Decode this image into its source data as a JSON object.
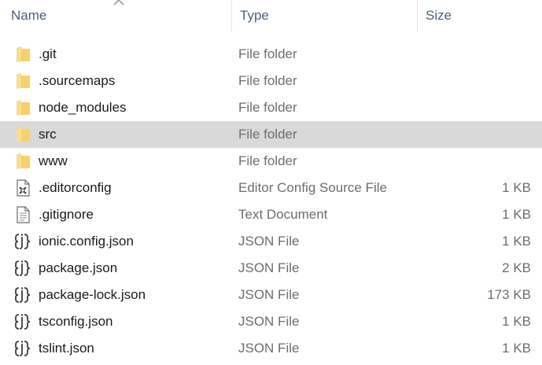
{
  "columns": {
    "name": "Name",
    "type": "Type",
    "size": "Size",
    "sorted_by": "name",
    "sort_direction": "ascending"
  },
  "colors": {
    "header_text": "#4c607a",
    "selected_row": "#d9d9d9",
    "folder": "#f5d16f",
    "secondary_text": "#6d6d6d"
  },
  "files": [
    {
      "name": ".git",
      "type": "File folder",
      "size": "",
      "icon": "folder-icon",
      "selected": false
    },
    {
      "name": ".sourcemaps",
      "type": "File folder",
      "size": "",
      "icon": "folder-icon",
      "selected": false
    },
    {
      "name": "node_modules",
      "type": "File folder",
      "size": "",
      "icon": "folder-icon",
      "selected": false
    },
    {
      "name": "src",
      "type": "File folder",
      "size": "",
      "icon": "folder-icon",
      "selected": true
    },
    {
      "name": "www",
      "type": "File folder",
      "size": "",
      "icon": "folder-icon",
      "selected": false
    },
    {
      "name": ".editorconfig",
      "type": "Editor Config Source File",
      "size": "1 KB",
      "icon": "editorconfig-file-icon",
      "selected": false
    },
    {
      "name": ".gitignore",
      "type": "Text Document",
      "size": "1 KB",
      "icon": "text-file-icon",
      "selected": false
    },
    {
      "name": "ionic.config.json",
      "type": "JSON File",
      "size": "1 KB",
      "icon": "json-file-icon",
      "selected": false
    },
    {
      "name": "package.json",
      "type": "JSON File",
      "size": "2 KB",
      "icon": "json-file-icon",
      "selected": false
    },
    {
      "name": "package-lock.json",
      "type": "JSON File",
      "size": "173 KB",
      "icon": "json-file-icon",
      "selected": false
    },
    {
      "name": "tsconfig.json",
      "type": "JSON File",
      "size": "1 KB",
      "icon": "json-file-icon",
      "selected": false
    },
    {
      "name": "tslint.json",
      "type": "JSON File",
      "size": "1 KB",
      "icon": "json-file-icon",
      "selected": false
    }
  ]
}
